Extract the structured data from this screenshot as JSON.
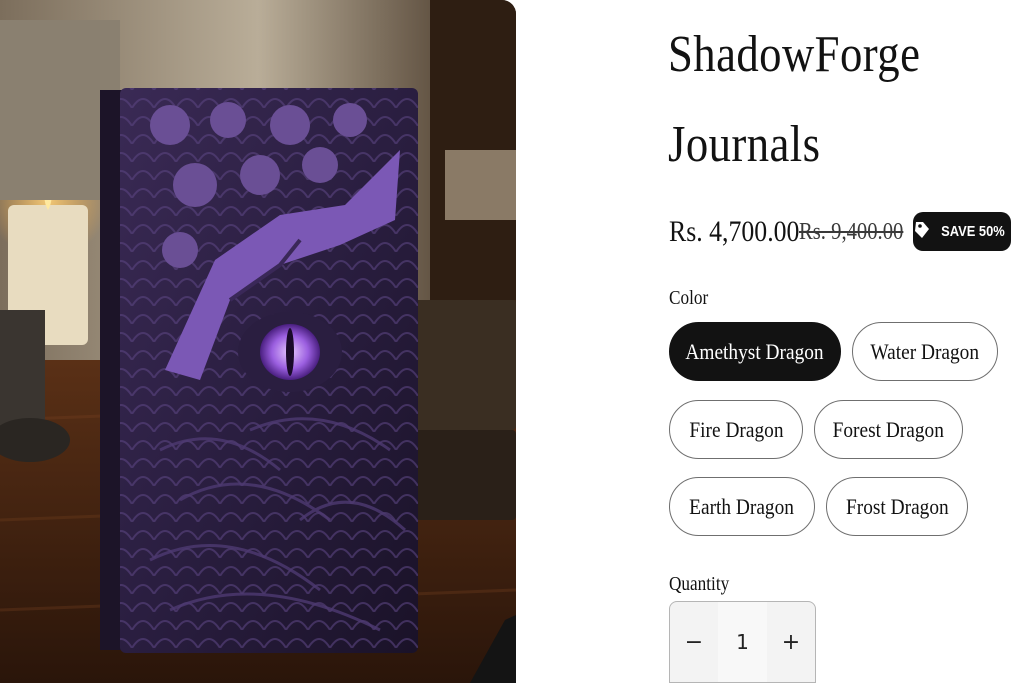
{
  "product": {
    "title_line1": "ShadowForge",
    "title_line2": "Journals",
    "image_alt": "Purple dragon eye journal",
    "price": "Rs. 4,700.00",
    "compare_price": "Rs. 9,400.00",
    "badge_icon": "tag-icon",
    "badge": "SAVE 50%"
  },
  "color": {
    "label": "Color",
    "options": [
      "Amethyst Dragon",
      "Water Dragon",
      "Fire Dragon",
      "Forest Dragon",
      "Earth Dragon",
      "Frost Dragon"
    ],
    "selected": "Amethyst Dragon"
  },
  "quantity": {
    "label": "Quantity",
    "value": "1",
    "minus": "−",
    "plus": "+"
  },
  "colors": {
    "primary": "#121212",
    "background": "#ffffff",
    "accent_purple": "#8a5cc8"
  }
}
